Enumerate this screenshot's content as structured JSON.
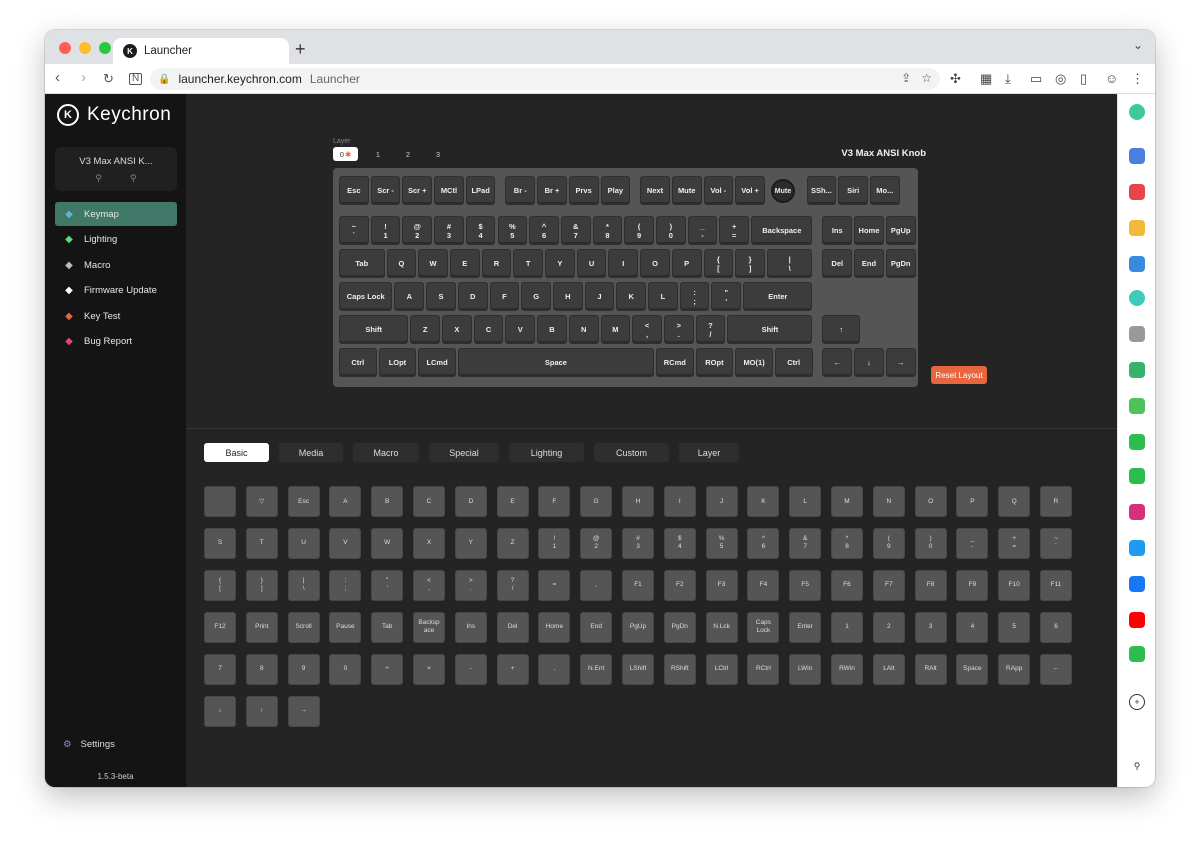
{
  "browser": {
    "tab_title": "Launcher",
    "url": "launcher.keychron.com",
    "page_title": "Launcher"
  },
  "app": {
    "brand": "Keychron",
    "device_name": "V3 Max ANSI K...",
    "version": "1.5.3-beta",
    "menu": [
      {
        "label": "Keymap",
        "icon": "keyboard-icon",
        "color": "#5fb3d9"
      },
      {
        "label": "Lighting",
        "icon": "bulb-icon",
        "color": "#5fd97a"
      },
      {
        "label": "Macro",
        "icon": "macro-icon",
        "color": "#bbbbbb"
      },
      {
        "label": "Firmware Update",
        "icon": "firmware-icon",
        "color": "#ffffff"
      },
      {
        "label": "Key Test",
        "icon": "key-test-icon",
        "color": "#e8663f"
      },
      {
        "label": "Bug Report",
        "icon": "bug-icon",
        "color": "#e0457b"
      }
    ],
    "settings_label": "Settings"
  },
  "keymap": {
    "layer_label": "Layer",
    "layers": [
      "0",
      "1",
      "2",
      "3"
    ],
    "active_layer": "0",
    "keyboard_title": "V3 Max ANSI Knob",
    "reset_label": "Reset Layout",
    "knob_label": "Mute",
    "rows": [
      [
        "Esc",
        "Scr -",
        "Scr +",
        "MCtl",
        "LPad",
        "Br -",
        "Br +",
        "Prvs",
        "Play",
        "Next",
        "Mute",
        "Vol -",
        "Vol +",
        "SSh...",
        "Siri",
        "Mo..."
      ],
      [
        "~\n`",
        "!\n1",
        "@\n2",
        "#\n3",
        "$\n4",
        "%\n5",
        "^\n6",
        "&\n7",
        "*\n8",
        "(\n9",
        ")\n0",
        "_\n-",
        "+\n=",
        "Backspace",
        "Ins",
        "Home",
        "PgUp"
      ],
      [
        "Tab",
        "Q",
        "W",
        "E",
        "R",
        "T",
        "Y",
        "U",
        "I",
        "O",
        "P",
        "{\n[",
        "}\n]",
        "|\n\\",
        "Del",
        "End",
        "PgDn"
      ],
      [
        "Caps Lock",
        "A",
        "S",
        "D",
        "F",
        "G",
        "H",
        "J",
        "K",
        "L",
        ":\n;",
        "\"\n'",
        "Enter"
      ],
      [
        "Shift",
        "Z",
        "X",
        "C",
        "V",
        "B",
        "N",
        "M",
        "<\n,",
        ">\n.",
        "?\n/",
        "Shift",
        "↑"
      ],
      [
        "Ctrl",
        "LOpt",
        "LCmd",
        "Space",
        "RCmd",
        "ROpt",
        "MO(1)",
        "Ctrl",
        "←",
        "↓",
        "→"
      ]
    ]
  },
  "palette": {
    "tabs": [
      "Basic",
      "Media",
      "Macro",
      "Special",
      "Lighting",
      "Custom",
      "Layer"
    ],
    "active_tab": "Basic",
    "keys": [
      "",
      "▽",
      "Esc",
      "A",
      "B",
      "C",
      "D",
      "E",
      "F",
      "G",
      "H",
      "I",
      "J",
      "K",
      "L",
      "M",
      "N",
      "O",
      "P",
      "Q",
      "R",
      "S",
      "T",
      "U",
      "V",
      "W",
      "X",
      "Y",
      "Z",
      "!\n1",
      "@\n2",
      "#\n3",
      "$\n4",
      "%\n5",
      "^\n6",
      "&\n7",
      "*\n8",
      "(\n9",
      ")\n0",
      "_\n-",
      "+\n=",
      "~\n`",
      "{\n[",
      "}\n]",
      "|\n\\",
      ":\n;",
      "\"\n'",
      "<\n,",
      ">\n.",
      "?\n/",
      "=",
      ",",
      "F1",
      "F2",
      "F3",
      "F4",
      "F5",
      "F6",
      "F7",
      "F8",
      "F9",
      "F10",
      "F11",
      "F12",
      "Print",
      "Scroll",
      "Pause",
      "Tab",
      "Backsp\nace",
      "Ins",
      "Del",
      "Home",
      "End",
      "PgUp",
      "PgDn",
      "N.Lck",
      "Caps\nLock",
      "Enter",
      "1",
      "2",
      "3",
      "4",
      "5",
      "6",
      "7",
      "8",
      "9",
      "0",
      "÷",
      "×",
      "-",
      "+",
      ".",
      "N.Ent",
      "LShift",
      "RShift",
      "LCtrl",
      "RCtrl",
      "LWin",
      "RWin",
      "LAlt",
      "RAlt",
      "Space",
      "RApp",
      "←",
      "↓",
      "↑",
      "→"
    ]
  },
  "colors": {
    "accent": "#3f7866",
    "reset": "#e8663f",
    "background": "#242424",
    "sidebar": "#141414"
  }
}
